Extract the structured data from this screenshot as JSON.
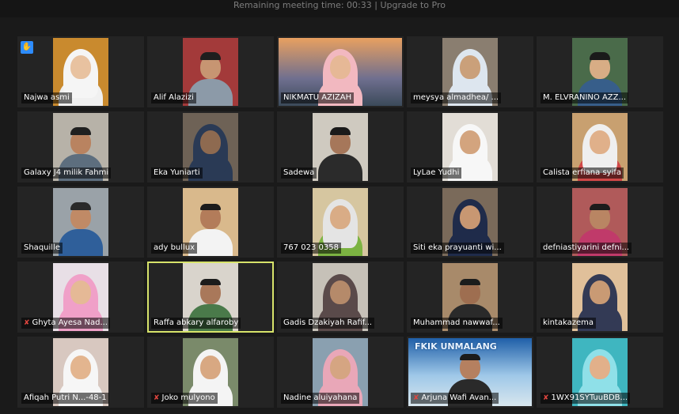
{
  "top_banner": "Remaining meeting time: 00:33 | Upgrade to Pro",
  "participants": [
    {
      "name": "Najwa asmi",
      "muted": false,
      "hand": true,
      "wall": "#c98a2e",
      "skin": "#e8c2a0",
      "cover": "hijab",
      "cover_color": "#f5f5f5",
      "cloth": "#f0f0f0"
    },
    {
      "name": "Alif Alazizi",
      "muted": false,
      "hand": false,
      "wall": "#a33a3a",
      "skin": "#c79572",
      "cover": "cap",
      "cover_color": "#1e1e1e",
      "cloth": "#8c9aa8"
    },
    {
      "name": "NIKMATU AZIZAH",
      "muted": false,
      "hand": false,
      "wall": "sky",
      "skin": "#e6b896",
      "cover": "hijab",
      "cover_color": "#f2b8c0",
      "cloth": "#f2b8c0"
    },
    {
      "name": "meysya almadhea/ ...",
      "muted": false,
      "hand": false,
      "wall": "#8a7e70",
      "skin": "#caa07a",
      "cover": "hijab",
      "cover_color": "#dde6ef",
      "cloth": "#dde6ef"
    },
    {
      "name": "M. ELVRANINO AZZ...",
      "muted": false,
      "hand": false,
      "wall": "#4a6b4a",
      "skin": "#d8ad85",
      "cover": "cap",
      "cover_color": "#1a1a1a",
      "cloth": "#375e8a"
    },
    {
      "name": "Galaxy J4 milik Fahmi",
      "muted": false,
      "hand": false,
      "wall": "#b7b2a8",
      "skin": "#b98360",
      "cover": "cap",
      "cover_color": "#202020",
      "cloth": "#5d6e7e"
    },
    {
      "name": "Eka Yuniarti",
      "muted": false,
      "hand": false,
      "wall": "#6e6256",
      "skin": "#8e6a50",
      "cover": "hijab",
      "cover_color": "#2a3a55",
      "cloth": "#2a3a55"
    },
    {
      "name": "Sadewa",
      "muted": false,
      "hand": false,
      "wall": "#cfcac0",
      "skin": "#a6775a",
      "cover": "cap",
      "cover_color": "#1a1a1a",
      "cloth": "#2b2b2b"
    },
    {
      "name": "LyLae Yudhi",
      "muted": false,
      "hand": false,
      "wall": "#e2ddd6",
      "skin": "#d3a47e",
      "cover": "hijab",
      "cover_color": "#f7f7f7",
      "cloth": "#f7f7f7"
    },
    {
      "name": "Calista erfiana syifa",
      "muted": false,
      "hand": false,
      "wall": "#c8a070",
      "skin": "#e0b08a",
      "cover": "hijab",
      "cover_color": "#efefef",
      "cloth": "#d04848"
    },
    {
      "name": "Shaquille",
      "muted": false,
      "hand": false,
      "wall": "#9aa2a8",
      "skin": "#c08a66",
      "cover": "cap",
      "cover_color": "#2a2a2a",
      "cloth": "#2f5f9a"
    },
    {
      "name": "ady bullux",
      "muted": false,
      "hand": false,
      "wall": "#d9b98c",
      "skin": "#b37c5a",
      "cover": "none",
      "cover_color": "#1c1c1c",
      "cloth": "#f3f3f3"
    },
    {
      "name": "767 023 0358",
      "muted": false,
      "hand": false,
      "wall": "#d6c6a0",
      "skin": "#d9ac86",
      "cover": "hijab",
      "cover_color": "#e4e4e4",
      "cloth": "#7cb342"
    },
    {
      "name": "Siti eka prayuanti wi...",
      "muted": false,
      "hand": false,
      "wall": "#7a6a5a",
      "skin": "#c89772",
      "cover": "hijab",
      "cover_color": "#1f2b4a",
      "cloth": "#1f2b4a"
    },
    {
      "name": "defniastiyarini defni...",
      "muted": false,
      "hand": false,
      "wall": "#b05a5a",
      "skin": "#b98563",
      "cover": "none",
      "cover_color": "#1c1c1c",
      "cloth": "#c03a6a"
    },
    {
      "name": "Ghyta Ayesa Nad...",
      "muted": true,
      "hand": false,
      "wall": "#e8dfe6",
      "skin": "#e5b996",
      "cover": "hijab",
      "cover_color": "#f0a0c8",
      "cloth": "#f0a0c8"
    },
    {
      "name": "Raffa abkary alfaroby",
      "muted": false,
      "hand": false,
      "active": true,
      "wall": "#d9d4cc",
      "skin": "#a9785a",
      "cover": "none",
      "cover_color": "#1c1c1c",
      "cloth": "#4a7a4a"
    },
    {
      "name": "Gadis Dzakiyah Rafif...",
      "muted": false,
      "hand": false,
      "wall": "#c6c1b8",
      "skin": "#b58a6a",
      "cover": "hijab",
      "cover_color": "#5a4a4a",
      "cloth": "#5a4a4a"
    },
    {
      "name": "Muhammad nawwaf...",
      "muted": false,
      "hand": false,
      "wall": "#a88a6a",
      "skin": "#9e6e50",
      "cover": "none",
      "cover_color": "#1c1c1c",
      "cloth": "#2a2a2a"
    },
    {
      "name": "kintakazema",
      "muted": false,
      "hand": false,
      "wall": "#e0c09a",
      "skin": "#c99a74",
      "cover": "hijab",
      "cover_color": "#333a55",
      "cloth": "#333a55"
    },
    {
      "name": "Afiqah Putri N...-48-1",
      "muted": false,
      "hand": false,
      "wall": "#d8c8c0",
      "skin": "#e3b58f",
      "cover": "hijab",
      "cover_color": "#f6f6f6",
      "cloth": "#f6f6f6"
    },
    {
      "name": "Joko mulyono",
      "muted": true,
      "hand": false,
      "wall": "#7a8a6a",
      "skin": "#d8a882",
      "cover": "hijab",
      "cover_color": "#f4f4f4",
      "cloth": "#f4f4f4"
    },
    {
      "name": "Nadine aluiyahana",
      "muted": false,
      "hand": false,
      "wall": "#8aa0b0",
      "skin": "#d5a582",
      "cover": "hijab",
      "cover_color": "#e9a7b8",
      "cloth": "#e9a7b8"
    },
    {
      "name": "Arjuna Wafi Avan...",
      "muted": true,
      "hand": false,
      "wall": "banner",
      "skin": "#b58060",
      "cover": "none",
      "cover_color": "#1c1c1c",
      "cloth": "#2a2a2a",
      "banner_text": "FKIK UNMALANG"
    },
    {
      "name": "1WX91SYTuuBDB...",
      "muted": true,
      "hand": false,
      "wall": "#3fb6c0",
      "skin": "#e2b08a",
      "cover": "hijab",
      "cover_color": "#8fe0e8",
      "cloth": "#8fe0e8"
    }
  ]
}
